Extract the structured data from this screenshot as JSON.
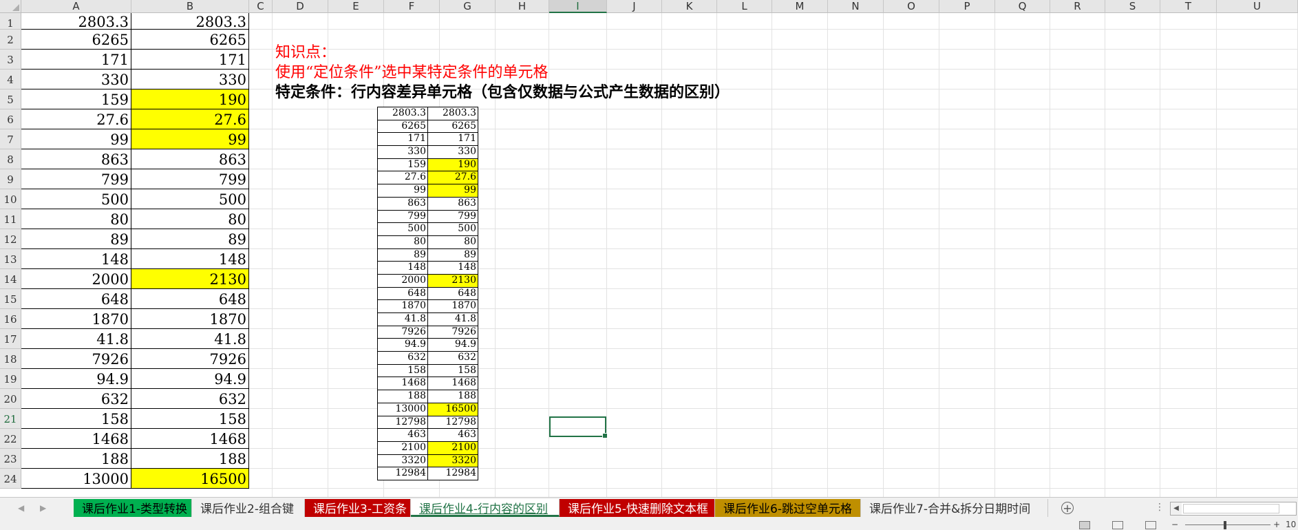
{
  "spreadsheet": {
    "columns": [
      "A",
      "B",
      "C",
      "D",
      "E",
      "F",
      "G",
      "H",
      "I",
      "J",
      "K",
      "L",
      "M",
      "N",
      "O",
      "P",
      "Q",
      "R",
      "S",
      "T",
      "U"
    ],
    "active_column": "I",
    "active_row": "21",
    "rows": [
      {
        "n": "1",
        "a": "2803.3",
        "b": "2803.3",
        "hl": false
      },
      {
        "n": "2",
        "a": "6265",
        "b": "6265",
        "hl": false
      },
      {
        "n": "3",
        "a": "171",
        "b": "171",
        "hl": false
      },
      {
        "n": "4",
        "a": "330",
        "b": "330",
        "hl": false
      },
      {
        "n": "5",
        "a": "159",
        "b": "190",
        "hl": true
      },
      {
        "n": "6",
        "a": "27.6",
        "b": "27.6",
        "hl": true
      },
      {
        "n": "7",
        "a": "99",
        "b": "99",
        "hl": true
      },
      {
        "n": "8",
        "a": "863",
        "b": "863",
        "hl": false
      },
      {
        "n": "9",
        "a": "799",
        "b": "799",
        "hl": false
      },
      {
        "n": "10",
        "a": "500",
        "b": "500",
        "hl": false
      },
      {
        "n": "11",
        "a": "80",
        "b": "80",
        "hl": false
      },
      {
        "n": "12",
        "a": "89",
        "b": "89",
        "hl": false
      },
      {
        "n": "13",
        "a": "148",
        "b": "148",
        "hl": false
      },
      {
        "n": "14",
        "a": "2000",
        "b": "2130",
        "hl": true
      },
      {
        "n": "15",
        "a": "648",
        "b": "648",
        "hl": false
      },
      {
        "n": "16",
        "a": "1870",
        "b": "1870",
        "hl": false
      },
      {
        "n": "17",
        "a": "41.8",
        "b": "41.8",
        "hl": false
      },
      {
        "n": "18",
        "a": "7926",
        "b": "7926",
        "hl": false
      },
      {
        "n": "19",
        "a": "94.9",
        "b": "94.9",
        "hl": false
      },
      {
        "n": "20",
        "a": "632",
        "b": "632",
        "hl": false
      },
      {
        "n": "21",
        "a": "158",
        "b": "158",
        "hl": false
      },
      {
        "n": "22",
        "a": "1468",
        "b": "1468",
        "hl": false
      },
      {
        "n": "23",
        "a": "188",
        "b": "188",
        "hl": false
      },
      {
        "n": "24",
        "a": "13000",
        "b": "16500",
        "hl": true
      }
    ]
  },
  "notes": {
    "line1": "知识点：",
    "line2": "使用“定位条件”选中某特定条件的单元格",
    "line3": "特定条件：行内容差异单元格（包含仅数据与公式产生数据的区别）"
  },
  "mini_table": [
    {
      "a": "2803.3",
      "b": "2803.3",
      "hl": false
    },
    {
      "a": "6265",
      "b": "6265",
      "hl": false
    },
    {
      "a": "171",
      "b": "171",
      "hl": false
    },
    {
      "a": "330",
      "b": "330",
      "hl": false
    },
    {
      "a": "159",
      "b": "190",
      "hl": true
    },
    {
      "a": "27.6",
      "b": "27.6",
      "hl": true
    },
    {
      "a": "99",
      "b": "99",
      "hl": true
    },
    {
      "a": "863",
      "b": "863",
      "hl": false
    },
    {
      "a": "799",
      "b": "799",
      "hl": false
    },
    {
      "a": "500",
      "b": "500",
      "hl": false
    },
    {
      "a": "80",
      "b": "80",
      "hl": false
    },
    {
      "a": "89",
      "b": "89",
      "hl": false
    },
    {
      "a": "148",
      "b": "148",
      "hl": false
    },
    {
      "a": "2000",
      "b": "2130",
      "hl": true
    },
    {
      "a": "648",
      "b": "648",
      "hl": false
    },
    {
      "a": "1870",
      "b": "1870",
      "hl": false
    },
    {
      "a": "41.8",
      "b": "41.8",
      "hl": false
    },
    {
      "a": "7926",
      "b": "7926",
      "hl": false
    },
    {
      "a": "94.9",
      "b": "94.9",
      "hl": false
    },
    {
      "a": "632",
      "b": "632",
      "hl": false
    },
    {
      "a": "158",
      "b": "158",
      "hl": false
    },
    {
      "a": "1468",
      "b": "1468",
      "hl": false
    },
    {
      "a": "188",
      "b": "188",
      "hl": false
    },
    {
      "a": "13000",
      "b": "16500",
      "hl": true
    },
    {
      "a": "12798",
      "b": "12798",
      "hl": false
    },
    {
      "a": "463",
      "b": "463",
      "hl": false
    },
    {
      "a": "2100",
      "b": "2100",
      "hl": true
    },
    {
      "a": "3320",
      "b": "3320",
      "hl": true
    },
    {
      "a": "12984",
      "b": "12984",
      "hl": false
    }
  ],
  "sheet_tabs": [
    {
      "label": "课后作业1-类型转换",
      "bg": "#00b050",
      "color": "#000000",
      "active": false
    },
    {
      "label": "课后作业2-组合键",
      "bg": "#f0f0f0",
      "color": "#333333",
      "active": false
    },
    {
      "label": "课后作业3-工资条",
      "bg": "#c00000",
      "color": "#ffffff",
      "active": false
    },
    {
      "label": "课后作业4-行内容的区别",
      "bg": "#ffffff",
      "color": "#217346",
      "active": true
    },
    {
      "label": "课后作业5-快速删除文本框",
      "bg": "#c00000",
      "color": "#ffffff",
      "active": false
    },
    {
      "label": "课后作业6-跳过空单元格",
      "bg": "#bf8f00",
      "color": "#000000",
      "active": false
    },
    {
      "label": "课后作业7-合并&拆分日期时间",
      "bg": "#f0f0f0",
      "color": "#333333",
      "active": false
    }
  ],
  "status": {
    "add_sheet_symbol": "+",
    "ellipsis": "⋮",
    "zoom_minus": "−",
    "zoom_plus": "+",
    "zoom_text": "10"
  },
  "icons": {
    "prev_sheet": "left-triangle-icon",
    "next_sheet": "right-triangle-icon"
  },
  "colors": {
    "highlight": "#ffff00",
    "accent": "#217346",
    "note_red": "#ff0000"
  }
}
